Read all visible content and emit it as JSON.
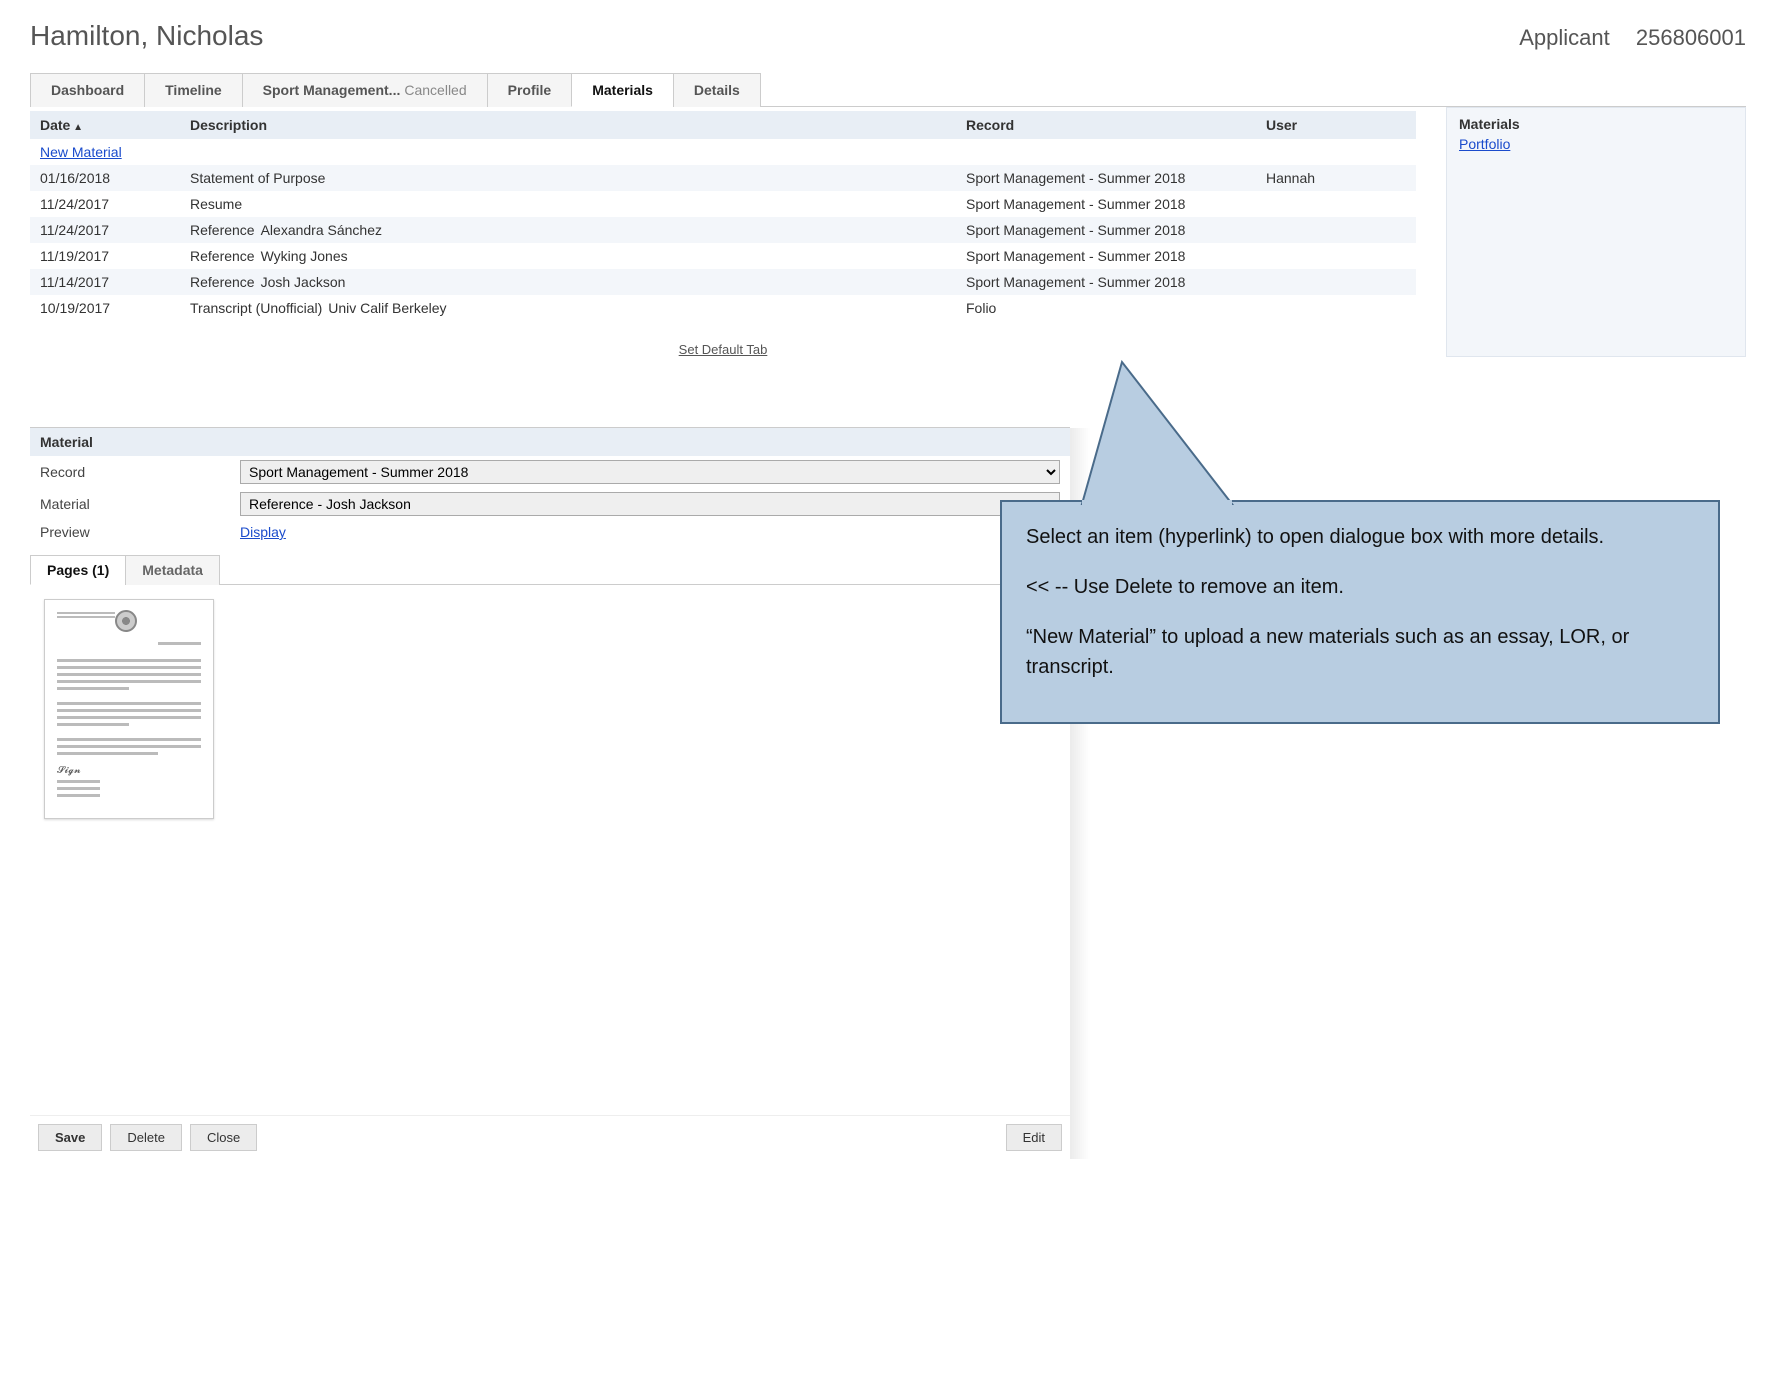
{
  "header": {
    "name": "Hamilton, Nicholas",
    "role": "Applicant",
    "id": "256806001"
  },
  "tabs": [
    {
      "label": "Dashboard"
    },
    {
      "label": "Timeline"
    },
    {
      "label": "Sport Management...",
      "status": "Cancelled"
    },
    {
      "label": "Profile"
    },
    {
      "label": "Materials",
      "active": true
    },
    {
      "label": "Details"
    }
  ],
  "table": {
    "headers": {
      "date": "Date",
      "description": "Description",
      "record": "Record",
      "user": "User"
    },
    "new_link": "New Material",
    "rows": [
      {
        "date": "01/16/2018",
        "desc": "Statement of Purpose",
        "desc_extra": "",
        "record": "Sport Management - Summer 2018",
        "user": "Hannah"
      },
      {
        "date": "11/24/2017",
        "desc": "Resume",
        "desc_extra": "",
        "record": "Sport Management - Summer 2018",
        "user": ""
      },
      {
        "date": "11/24/2017",
        "desc": "Reference",
        "desc_extra": "Alexandra Sánchez",
        "record": "Sport Management - Summer 2018",
        "user": ""
      },
      {
        "date": "11/19/2017",
        "desc": "Reference",
        "desc_extra": "Wyking Jones",
        "record": "Sport Management - Summer 2018",
        "user": ""
      },
      {
        "date": "11/14/2017",
        "desc": "Reference",
        "desc_extra": "Josh Jackson",
        "record": "Sport Management - Summer 2018",
        "user": ""
      },
      {
        "date": "10/19/2017",
        "desc": "Transcript (Unofficial)",
        "desc_extra": "Univ Calif Berkeley",
        "record": "Folio",
        "user": ""
      }
    ]
  },
  "set_default_label": "Set Default Tab",
  "sidebar": {
    "title": "Materials",
    "link": "Portfolio"
  },
  "detail": {
    "heading": "Material",
    "record_label": "Record",
    "record_value": "Sport Management - Summer 2018",
    "material_label": "Material",
    "material_value": "Reference - Josh Jackson",
    "preview_label": "Preview",
    "display_link": "Display",
    "subtabs": {
      "pages": "Pages (1)",
      "metadata": "Metadata"
    },
    "buttons": {
      "save": "Save",
      "delete": "Delete",
      "close": "Close",
      "edit": "Edit"
    }
  },
  "callout": {
    "p1": "Select an item (hyperlink) to open dialogue box with more details.",
    "p2": "<< -- Use Delete to remove an item.",
    "p3": "“New Material” to upload a new materials such as an essay, LOR, or transcript."
  }
}
